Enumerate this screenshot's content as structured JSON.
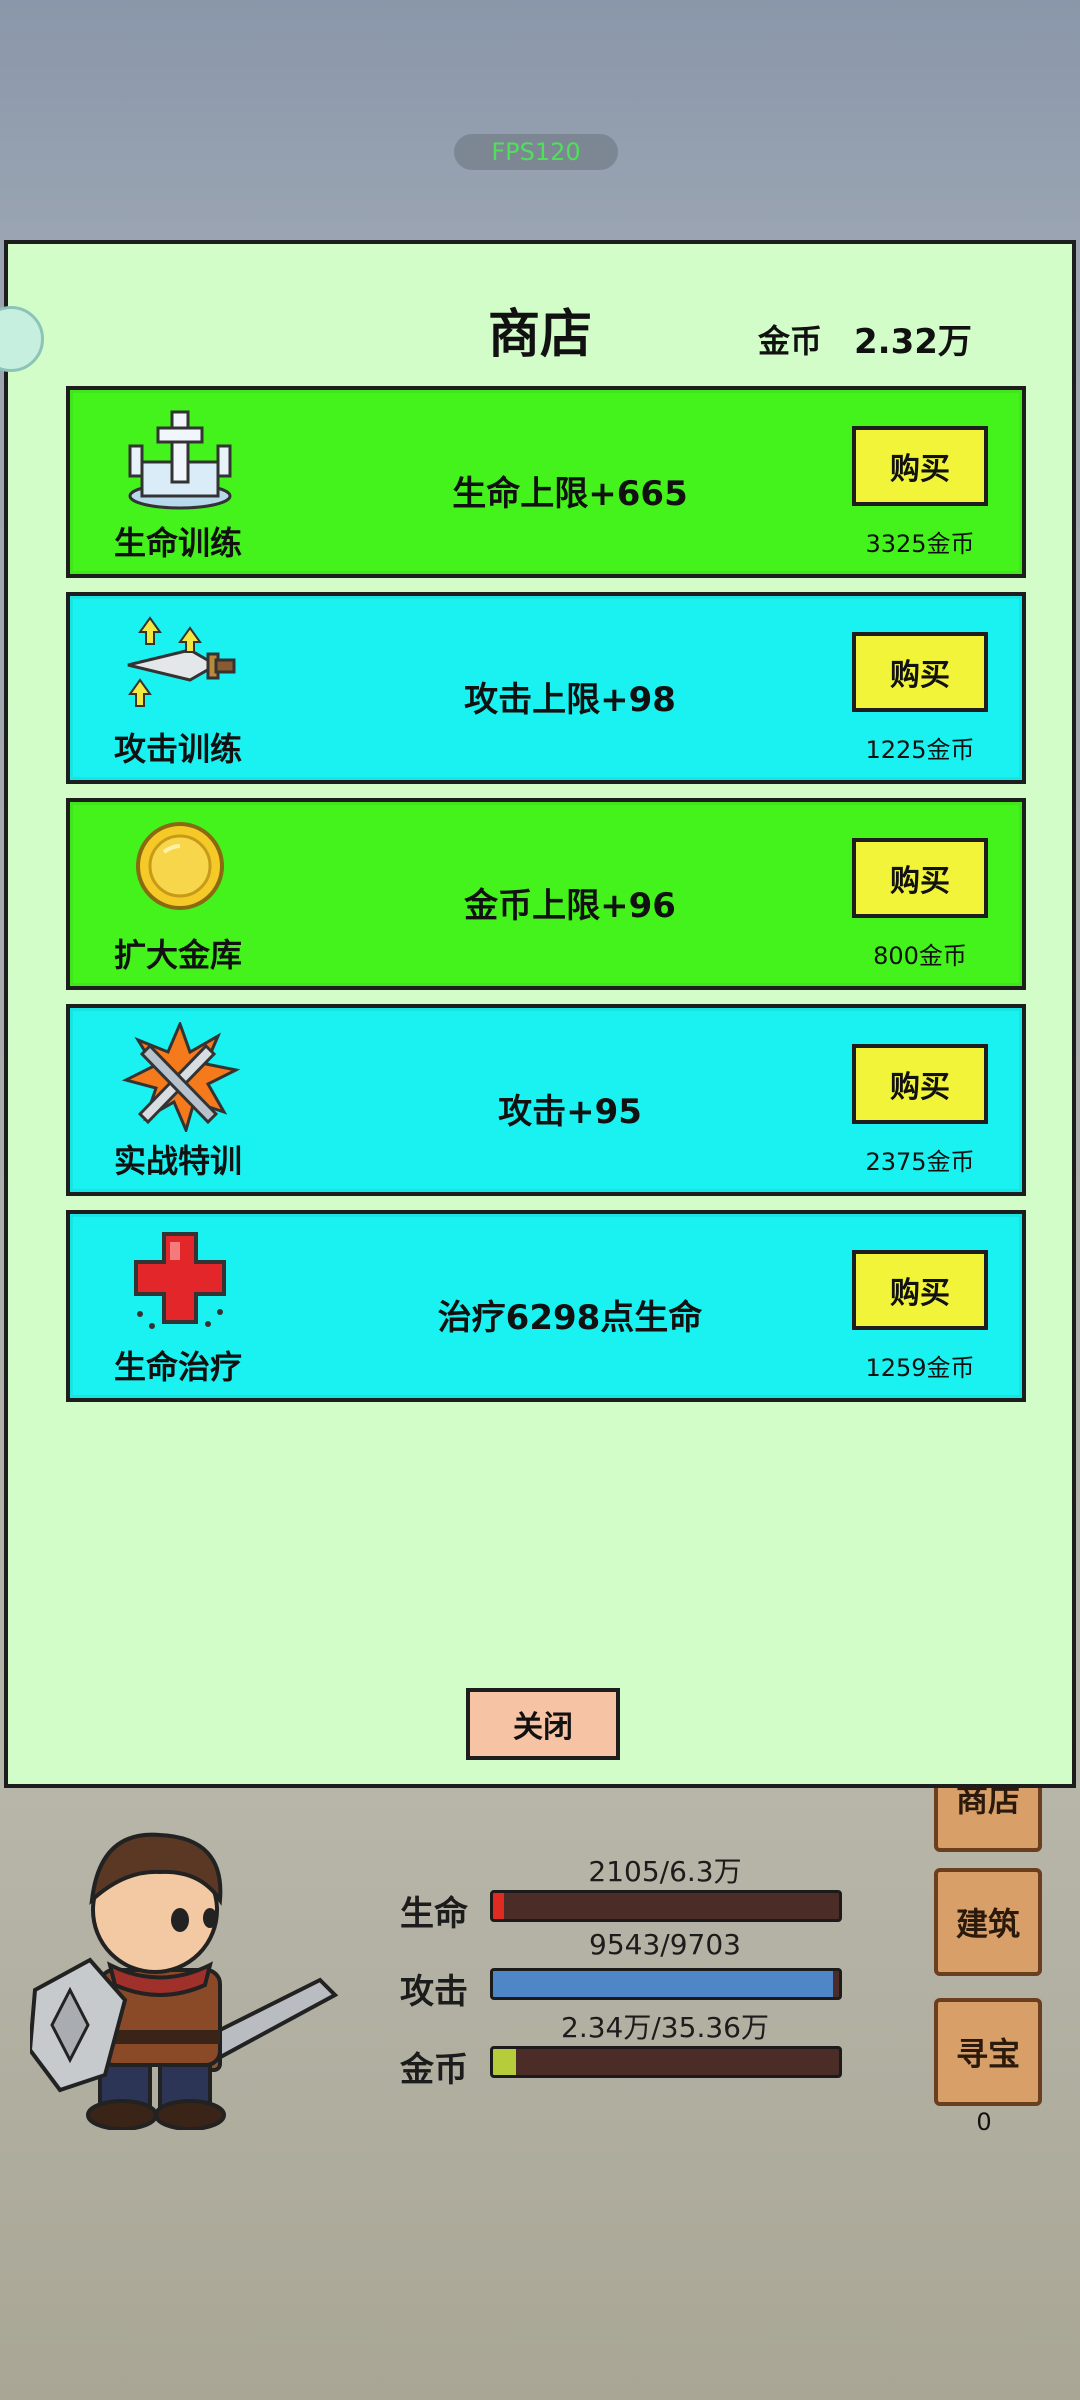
{
  "fps": "FPS120",
  "shop": {
    "title": "商店",
    "gold_label": "金币",
    "gold_value": "2.32万",
    "close_label": "关闭",
    "items": [
      {
        "name": "生命训练",
        "effect": "生命上限+665",
        "buy_label": "购买",
        "price": "3325金币",
        "color": "#45f31c",
        "icon": "health-statue-icon"
      },
      {
        "name": "攻击训练",
        "effect": "攻击上限+98",
        "buy_label": "购买",
        "price": "1225金币",
        "color": "#19f2f0",
        "icon": "sword-upgrade-icon"
      },
      {
        "name": "扩大金库",
        "effect": "金币上限+96",
        "buy_label": "购买",
        "price": "800金币",
        "color": "#45f31c",
        "icon": "gold-coin-icon"
      },
      {
        "name": "实战特训",
        "effect": "攻击+95",
        "buy_label": "购买",
        "price": "2375金币",
        "color": "#19f2f0",
        "icon": "burst-sword-icon"
      },
      {
        "name": "生命治疗",
        "effect": "治疗6298点生命",
        "buy_label": "购买",
        "price": "1259金币",
        "color": "#19f2f0",
        "icon": "red-cross-icon"
      }
    ]
  },
  "stats": {
    "hp": {
      "label": "生命",
      "value": "2105/6.3万",
      "fraction": 0.033,
      "color": "#e02a22"
    },
    "attack": {
      "label": "攻击",
      "value": "9543/9703",
      "fraction": 0.983,
      "color": "#4f86c8"
    },
    "gold": {
      "label": "金币",
      "value": "2.34万/35.36万",
      "fraction": 0.066,
      "color": "#b7cc3a"
    }
  },
  "side_buttons": {
    "shop": "商店",
    "build": "建筑",
    "treasure": "寻宝",
    "treasure_count": "0"
  }
}
